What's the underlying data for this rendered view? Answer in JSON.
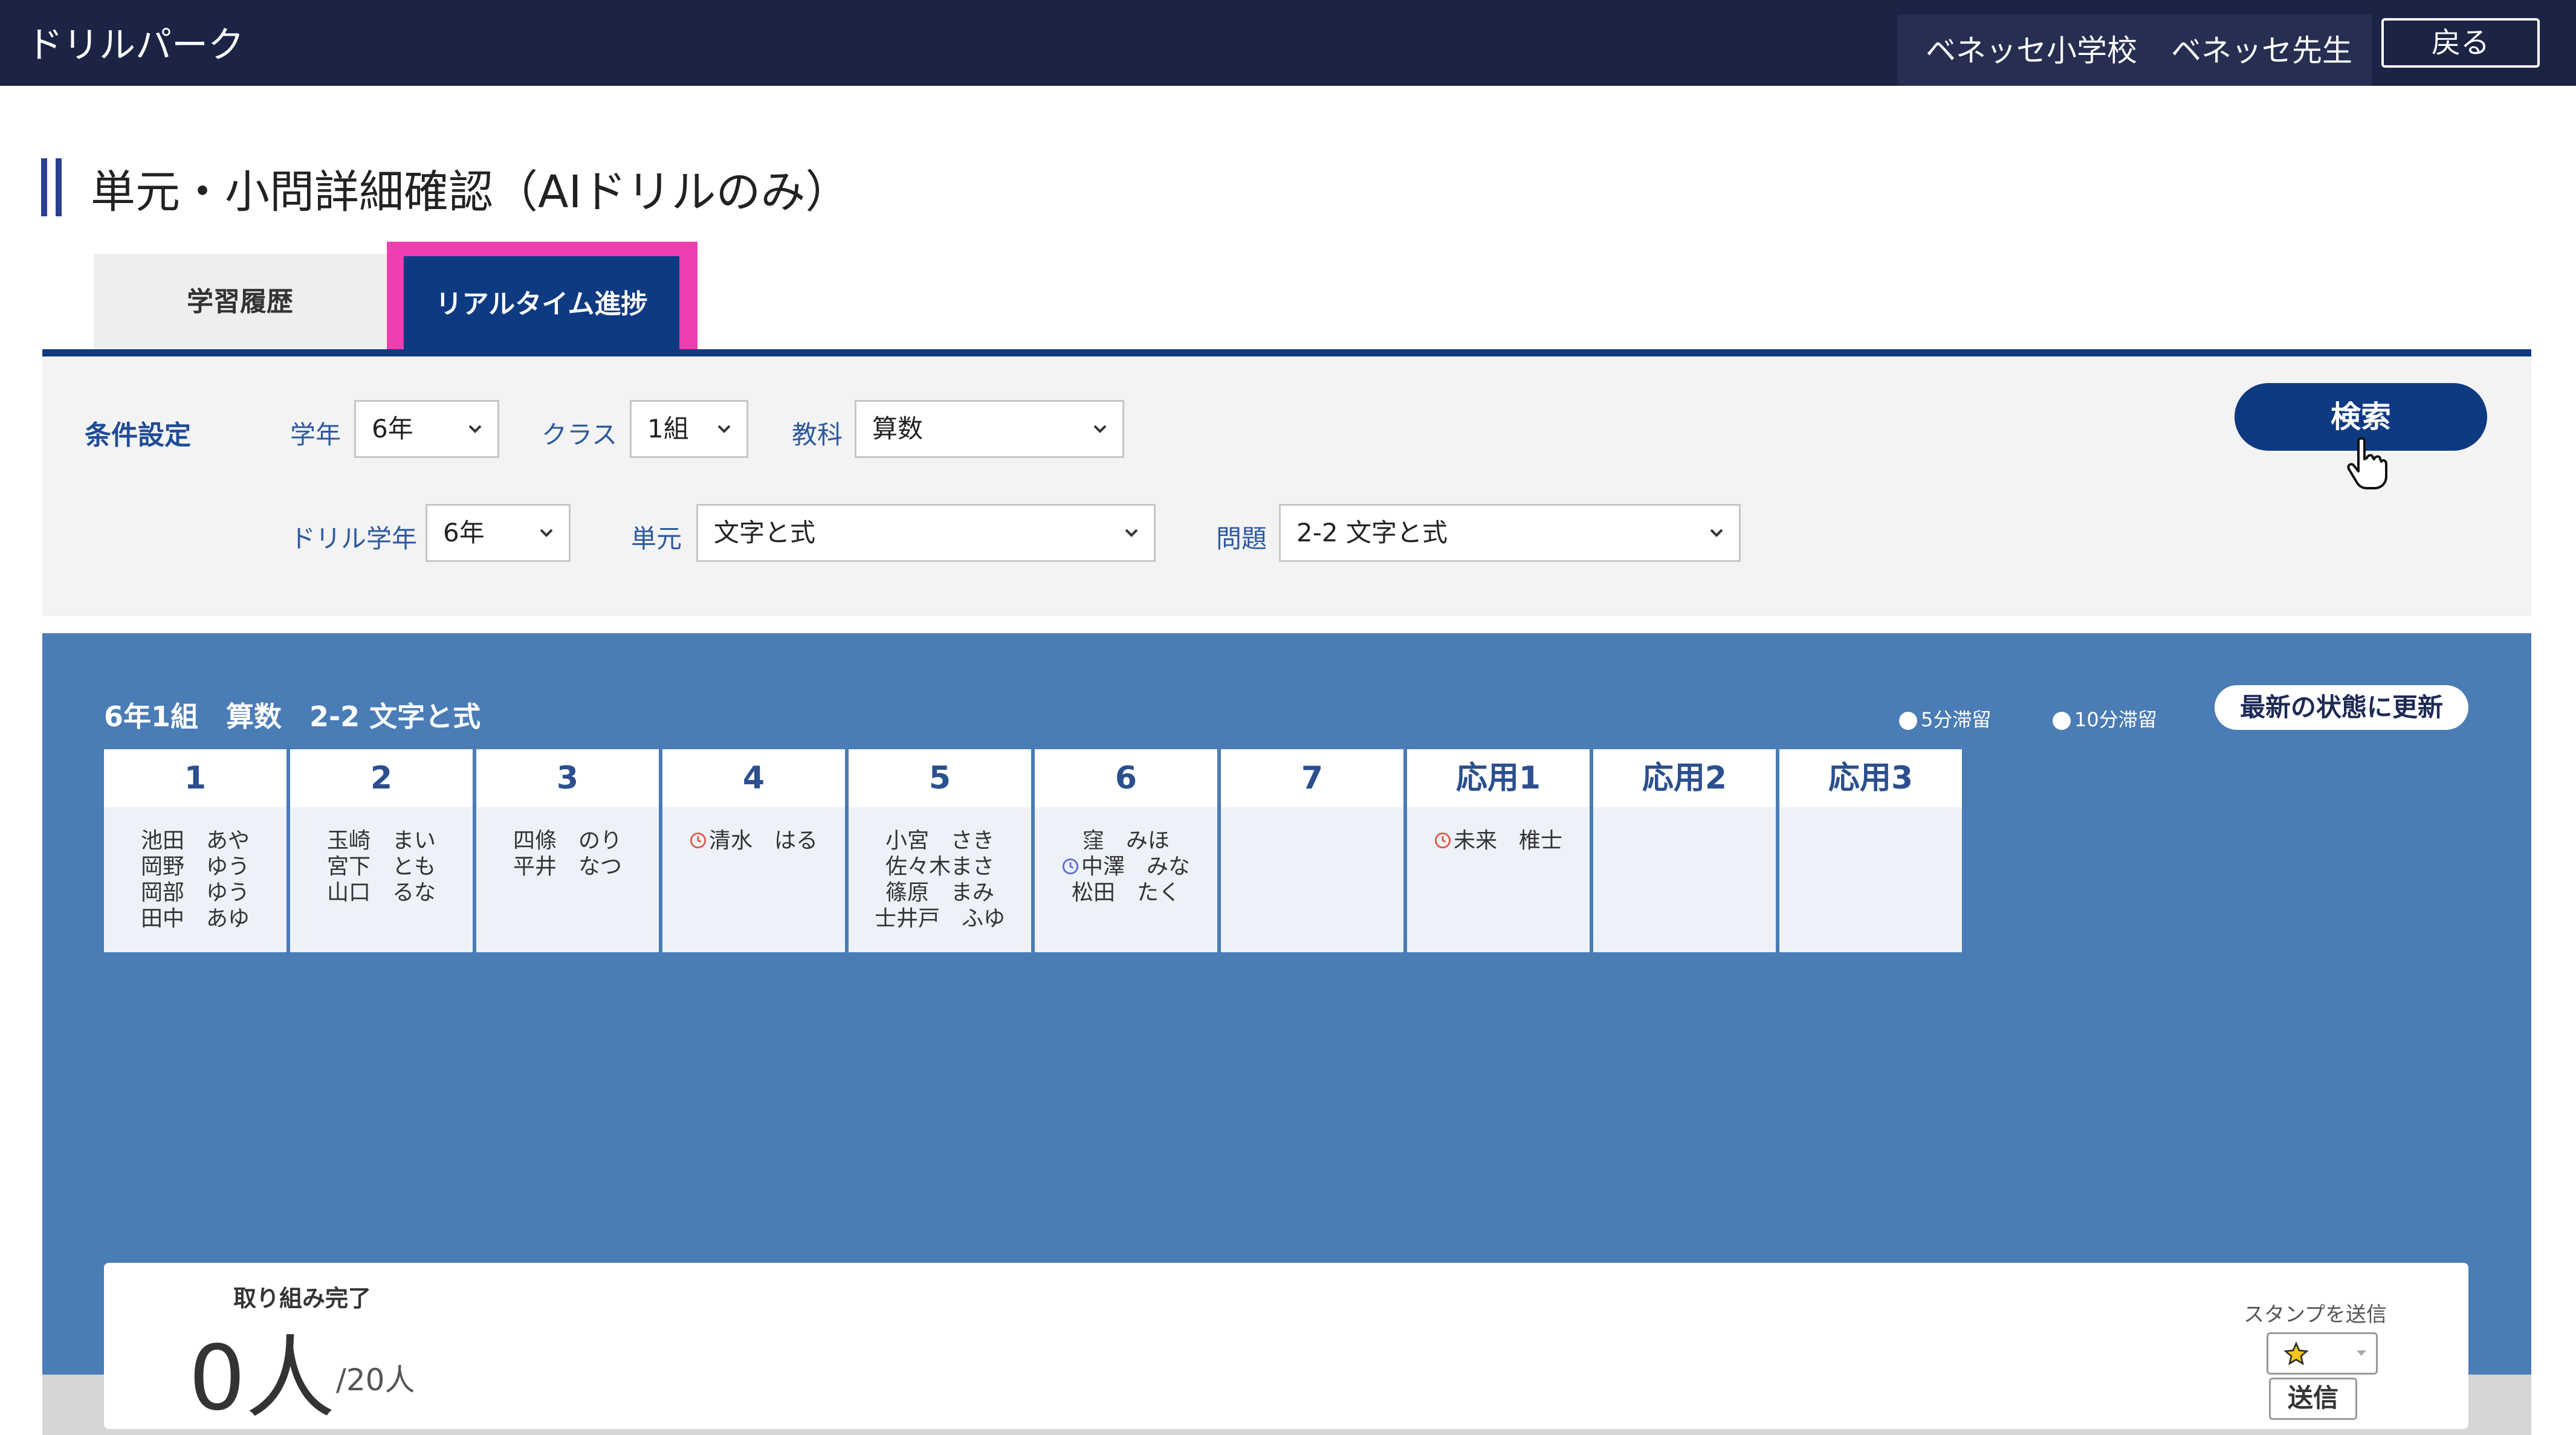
{
  "header": {
    "app_title": "ドリルパーク",
    "school": "ベネッセ小学校",
    "teacher": "ベネッセ先生",
    "back_label": "戻る"
  },
  "page": {
    "title": "単元・小問詳細確認（AIドリルのみ）"
  },
  "tabs": [
    {
      "label": "学習履歴",
      "active": false
    },
    {
      "label": "リアルタイム進捗",
      "active": true
    }
  ],
  "filters": {
    "section_label": "条件設定",
    "grade": {
      "label": "学年",
      "value": "6年"
    },
    "class": {
      "label": "クラス",
      "value": "1組"
    },
    "subject": {
      "label": "教科",
      "value": "算数"
    },
    "drill_grade": {
      "label": "ドリル学年",
      "value": "6年"
    },
    "unit": {
      "label": "単元",
      "value": "文字と式"
    },
    "question": {
      "label": "問題",
      "value": "2-2 文字と式"
    },
    "search_label": "検索"
  },
  "board": {
    "title": "6年1組　算数　2-2 文字と式",
    "legend_5min": "5分滞留",
    "legend_10min": "10分滞留",
    "refresh_label": "最新の状態に更新",
    "colors": {
      "stay_5min": "#5a6fd6",
      "stay_10min": "#e05a4a"
    },
    "columns": [
      {
        "head": "1",
        "names": [
          {
            "text": "池田　あや"
          },
          {
            "text": "岡野　ゆう"
          },
          {
            "text": "岡部　ゆう"
          },
          {
            "text": "田中　あゆ"
          }
        ]
      },
      {
        "head": "2",
        "names": [
          {
            "text": "玉崎　まい"
          },
          {
            "text": "宮下　とも"
          },
          {
            "text": "山口　るな"
          }
        ]
      },
      {
        "head": "3",
        "names": [
          {
            "text": "四條　のり"
          },
          {
            "text": "平井　なつ"
          }
        ]
      },
      {
        "head": "4",
        "names": [
          {
            "text": "清水　はる",
            "stay": "10min"
          }
        ]
      },
      {
        "head": "5",
        "names": [
          {
            "text": "小宮　さき"
          },
          {
            "text": "佐々木まさ"
          },
          {
            "text": "篠原　まみ"
          },
          {
            "text": "士井戸　ふゆ"
          }
        ]
      },
      {
        "head": "6",
        "names": [
          {
            "text": "窪　みほ"
          },
          {
            "text": "中澤　みな",
            "stay": "5min"
          },
          {
            "text": "松田　たく"
          }
        ]
      },
      {
        "head": "7",
        "names": []
      },
      {
        "head": "応用1",
        "names": [
          {
            "text": "未来　椎士",
            "stay": "10min"
          }
        ]
      },
      {
        "head": "応用2",
        "names": []
      },
      {
        "head": "応用3",
        "names": []
      }
    ]
  },
  "completion": {
    "label": "取り組み完了",
    "count": "0人",
    "total": "/20人"
  },
  "stamp": {
    "label": "スタンプを送信",
    "selected_icon": "star-icon",
    "send_label": "送信"
  }
}
